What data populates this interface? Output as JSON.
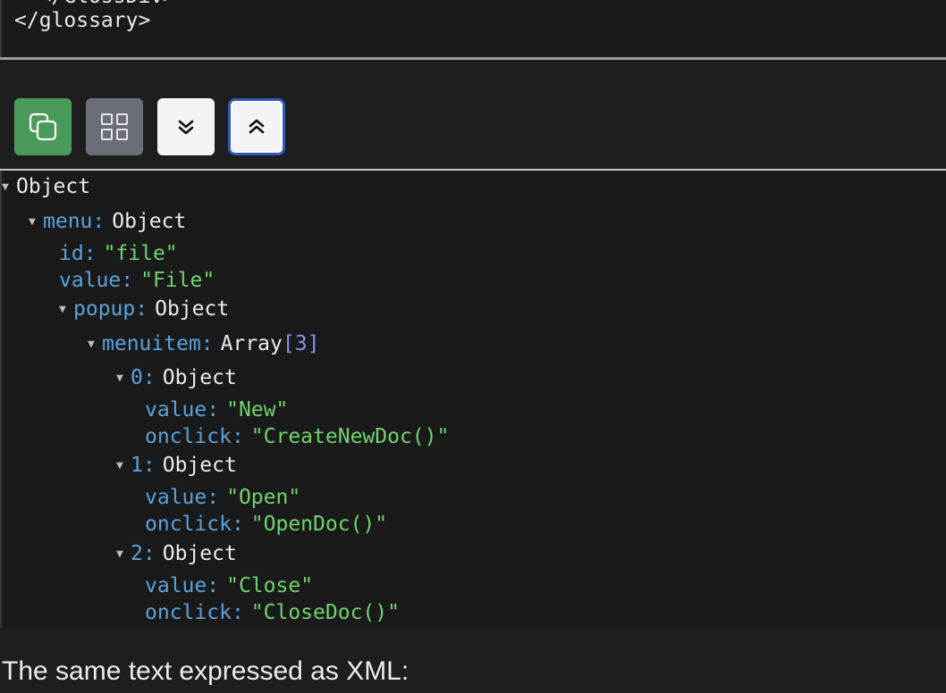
{
  "code_block": {
    "lines": [
      "  </GlossDiv>",
      "</glossary>"
    ]
  },
  "toolbar": {
    "buttons": [
      {
        "name": "copy",
        "icon": "copy-icon",
        "color": "#4a9a5a"
      },
      {
        "name": "view",
        "icon": "grid-icon",
        "color": "#6a6e76"
      },
      {
        "name": "expand-all",
        "icon": "chevrons-down-icon",
        "color": "#f4f4f6"
      },
      {
        "name": "collapse-all",
        "icon": "chevrons-up-icon",
        "color": "#f4f4f6",
        "focused": true
      }
    ]
  },
  "tree": {
    "root": {
      "type": "Object"
    },
    "menu": {
      "key": "menu",
      "type": "Object"
    },
    "id": {
      "key": "id",
      "value": "\"file\""
    },
    "value": {
      "key": "value",
      "value": "\"File\""
    },
    "popup": {
      "key": "popup",
      "type": "Object"
    },
    "menuitem": {
      "key": "menuitem",
      "type": "Array",
      "count": "[3]"
    },
    "items": [
      {
        "index": "0",
        "type": "Object",
        "value_key": "value",
        "value": "\"New\"",
        "onclick_key": "onclick",
        "onclick": "\"CreateNewDoc()\""
      },
      {
        "index": "1",
        "type": "Object",
        "value_key": "value",
        "value": "\"Open\"",
        "onclick_key": "onclick",
        "onclick": "\"OpenDoc()\""
      },
      {
        "index": "2",
        "type": "Object",
        "value_key": "value",
        "value": "\"Close\"",
        "onclick_key": "onclick",
        "onclick": "\"CloseDoc()\""
      }
    ]
  },
  "bottom_text": "The same text expressed as XML:"
}
